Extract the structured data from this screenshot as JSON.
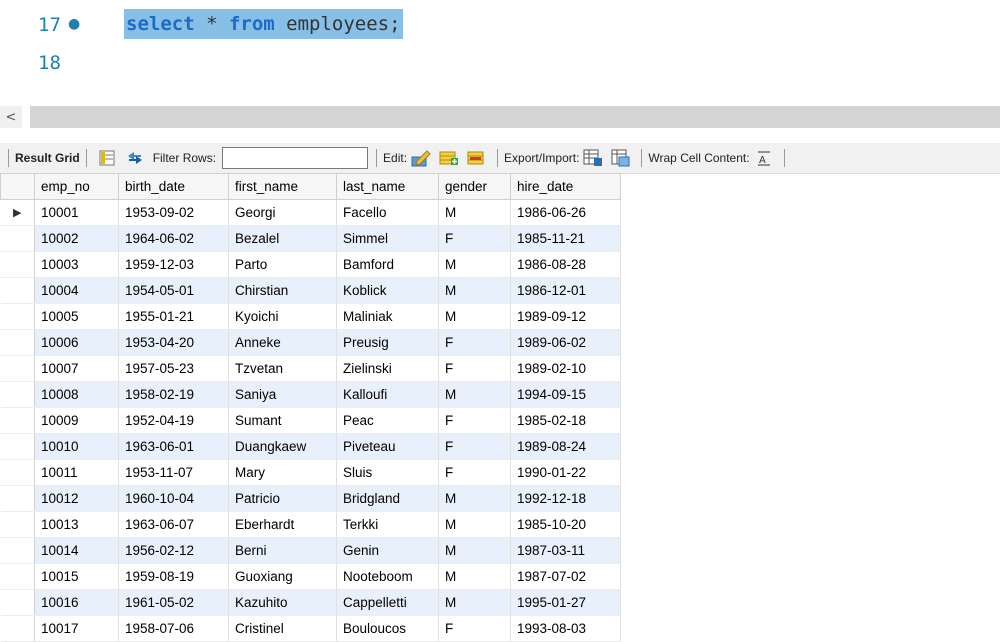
{
  "editor": {
    "lines": [
      {
        "number": "17",
        "has_dot": true,
        "code_keyword1": "select",
        "code_op": " * ",
        "code_keyword2": "from",
        "code_rest": " employees;"
      },
      {
        "number": "18",
        "has_dot": false
      }
    ]
  },
  "scrollbar": {
    "left_arrow": "<"
  },
  "toolbar": {
    "result_grid_label": "Result Grid",
    "filter_rows_label": "Filter Rows:",
    "filter_value": "",
    "edit_label": "Edit:",
    "export_import_label": "Export/Import:",
    "wrap_cell_label": "Wrap Cell Content:"
  },
  "grid": {
    "columns": [
      "emp_no",
      "birth_date",
      "first_name",
      "last_name",
      "gender",
      "hire_date"
    ],
    "rows": [
      [
        "10001",
        "1953-09-02",
        "Georgi",
        "Facello",
        "M",
        "1986-06-26"
      ],
      [
        "10002",
        "1964-06-02",
        "Bezalel",
        "Simmel",
        "F",
        "1985-11-21"
      ],
      [
        "10003",
        "1959-12-03",
        "Parto",
        "Bamford",
        "M",
        "1986-08-28"
      ],
      [
        "10004",
        "1954-05-01",
        "Chirstian",
        "Koblick",
        "M",
        "1986-12-01"
      ],
      [
        "10005",
        "1955-01-21",
        "Kyoichi",
        "Maliniak",
        "M",
        "1989-09-12"
      ],
      [
        "10006",
        "1953-04-20",
        "Anneke",
        "Preusig",
        "F",
        "1989-06-02"
      ],
      [
        "10007",
        "1957-05-23",
        "Tzvetan",
        "Zielinski",
        "F",
        "1989-02-10"
      ],
      [
        "10008",
        "1958-02-19",
        "Saniya",
        "Kalloufi",
        "M",
        "1994-09-15"
      ],
      [
        "10009",
        "1952-04-19",
        "Sumant",
        "Peac",
        "F",
        "1985-02-18"
      ],
      [
        "10010",
        "1963-06-01",
        "Duangkaew",
        "Piveteau",
        "F",
        "1989-08-24"
      ],
      [
        "10011",
        "1953-11-07",
        "Mary",
        "Sluis",
        "F",
        "1990-01-22"
      ],
      [
        "10012",
        "1960-10-04",
        "Patricio",
        "Bridgland",
        "M",
        "1992-12-18"
      ],
      [
        "10013",
        "1963-06-07",
        "Eberhardt",
        "Terkki",
        "M",
        "1985-10-20"
      ],
      [
        "10014",
        "1956-02-12",
        "Berni",
        "Genin",
        "M",
        "1987-03-11"
      ],
      [
        "10015",
        "1959-08-19",
        "Guoxiang",
        "Nooteboom",
        "M",
        "1987-07-02"
      ],
      [
        "10016",
        "1961-05-02",
        "Kazuhito",
        "Cappelletti",
        "M",
        "1995-01-27"
      ],
      [
        "10017",
        "1958-07-06",
        "Cristinel",
        "Bouloucos",
        "F",
        "1993-08-03"
      ]
    ],
    "current_row_marker": "▶"
  },
  "colors": {
    "selection": "#88bfe6",
    "keyword": "#1a6cc6",
    "line_number": "#1f7fb0",
    "alt_row": "#e8f0fc"
  }
}
